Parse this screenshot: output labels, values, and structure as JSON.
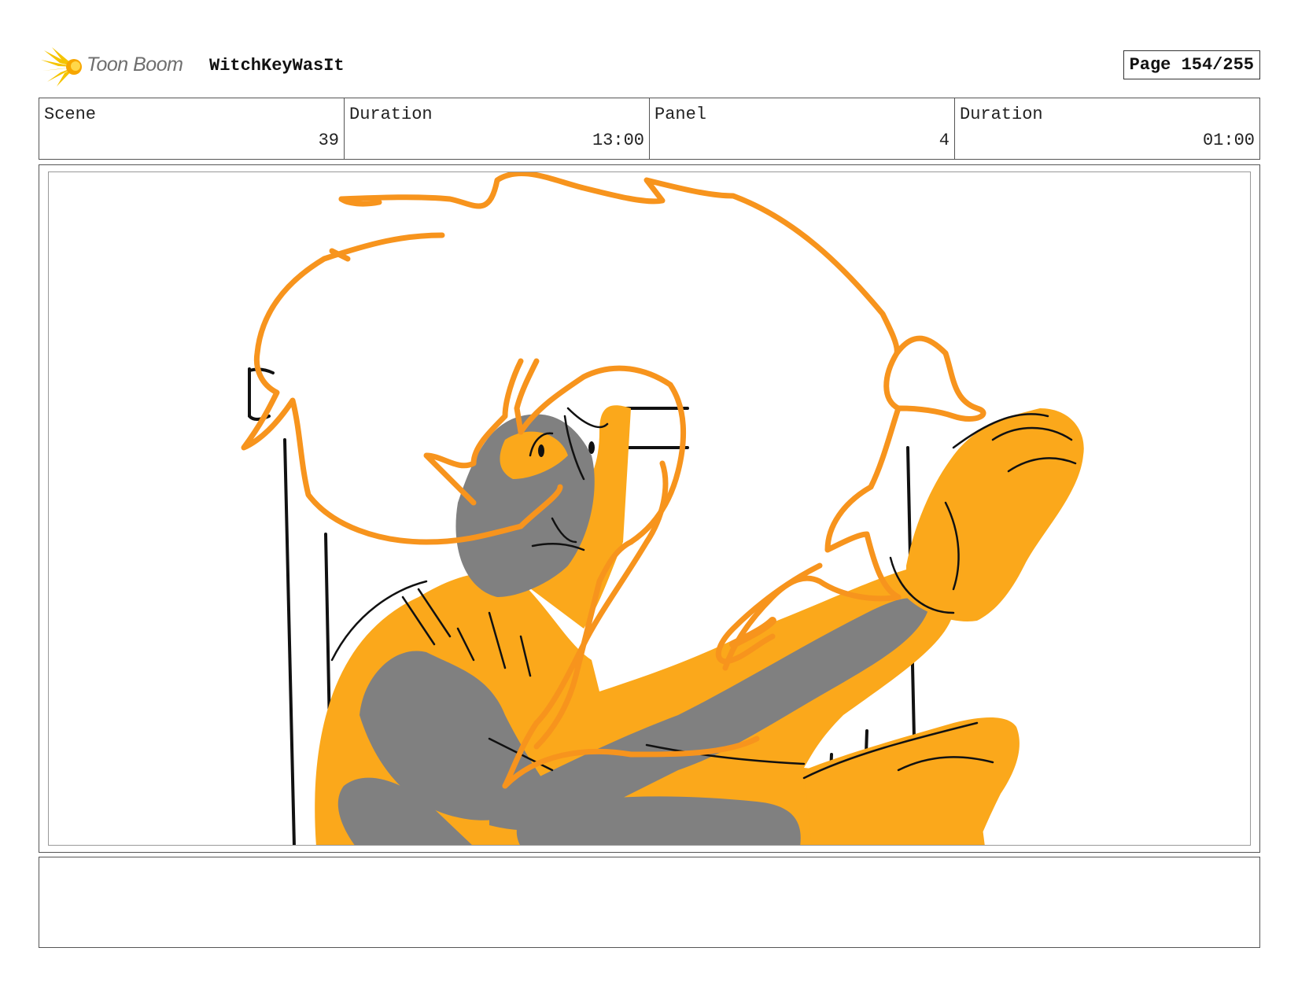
{
  "header": {
    "brand_logo_text": "Toon Boom",
    "project_title": "WitchKeyWasIt",
    "page_label": "Page 154/255"
  },
  "info": {
    "scene": {
      "label": "Scene",
      "value": "39"
    },
    "scene_duration": {
      "label": "Duration",
      "value": "13:00"
    },
    "panel": {
      "label": "Panel",
      "value": "4"
    },
    "panel_duration": {
      "label": "Duration",
      "value": "01:00"
    }
  },
  "colors": {
    "orange_line": "#f7941d",
    "orange_fill": "#fba81b",
    "gray_shadow": "#808080",
    "ink": "#111111"
  },
  "notes": {
    "text": ""
  }
}
